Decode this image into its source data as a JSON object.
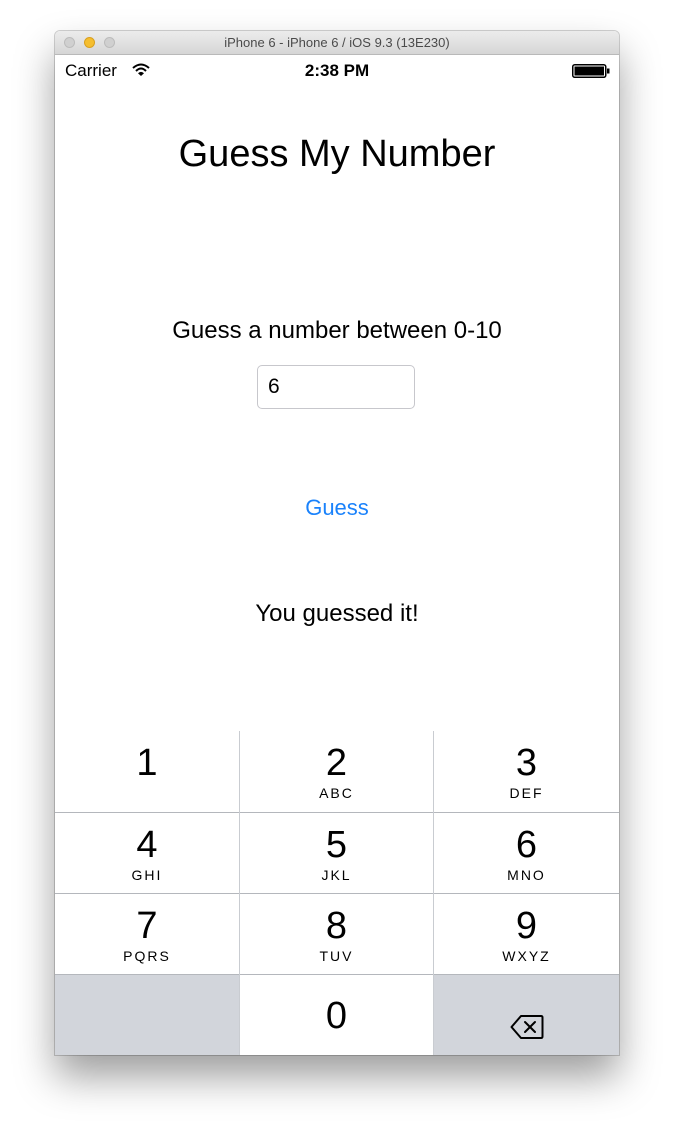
{
  "window": {
    "title": "iPhone 6 - iPhone 6 / iOS 9.3 (13E230)"
  },
  "status_bar": {
    "carrier": "Carrier",
    "time": "2:38 PM",
    "icons": [
      "wifi-icon",
      "battery-icon"
    ]
  },
  "app": {
    "title": "Guess My Number",
    "prompt": "Guess a number between 0-10",
    "input_value": "6",
    "guess_button": "Guess",
    "result": "You guessed it!"
  },
  "keypad": {
    "keys": [
      {
        "digit": "1",
        "letters": ""
      },
      {
        "digit": "2",
        "letters": "ABC"
      },
      {
        "digit": "3",
        "letters": "DEF"
      },
      {
        "digit": "4",
        "letters": "GHI"
      },
      {
        "digit": "5",
        "letters": "JKL"
      },
      {
        "digit": "6",
        "letters": "MNO"
      },
      {
        "digit": "7",
        "letters": "PQRS"
      },
      {
        "digit": "8",
        "letters": "TUV"
      },
      {
        "digit": "9",
        "letters": "WXYZ"
      },
      {
        "digit": "0",
        "letters": ""
      }
    ],
    "delete_icon": "backspace-icon"
  },
  "colors": {
    "accent": "#1a82fb",
    "keypad_blank": "#d2d5db",
    "minimize_button": "#f5be2f"
  }
}
